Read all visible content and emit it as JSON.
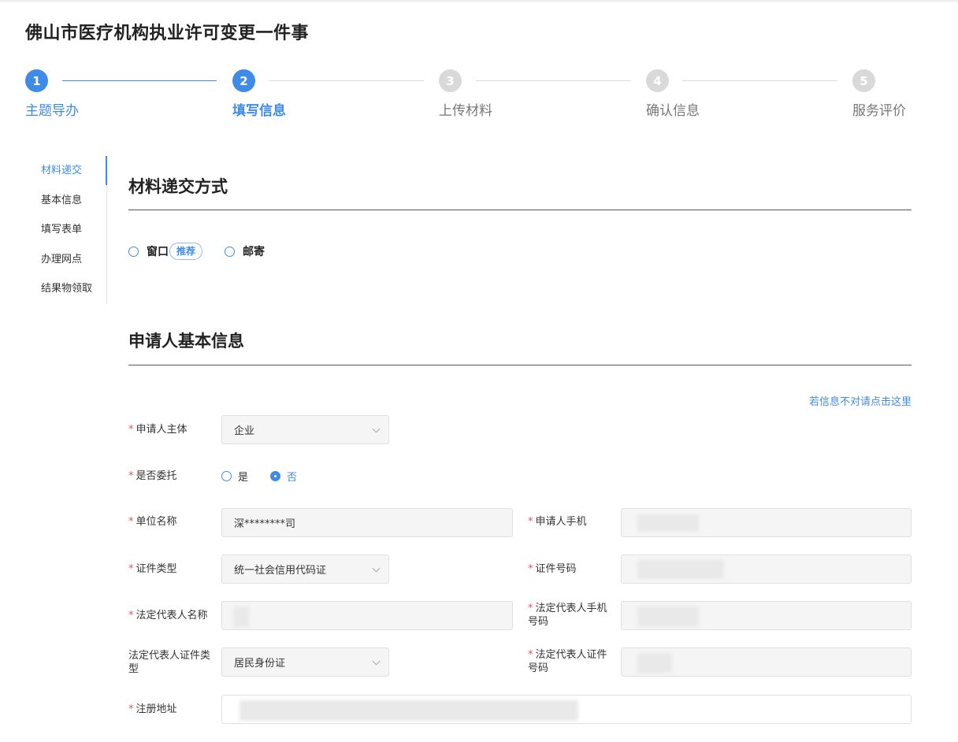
{
  "page": {
    "title": "佛山市医疗机构执业许可变更一件事"
  },
  "steps": [
    {
      "num": "1",
      "label": "主题导办",
      "state": "done"
    },
    {
      "num": "2",
      "label": "填写信息",
      "state": "current"
    },
    {
      "num": "3",
      "label": "上传材料",
      "state": "todo"
    },
    {
      "num": "4",
      "label": "确认信息",
      "state": "todo"
    },
    {
      "num": "5",
      "label": "服务评价",
      "state": "todo"
    }
  ],
  "sidebar": {
    "items": [
      {
        "label": "材料递交",
        "active": true
      },
      {
        "label": "基本信息"
      },
      {
        "label": "填写表单"
      },
      {
        "label": "办理网点"
      },
      {
        "label": "结果物领取"
      }
    ]
  },
  "delivery": {
    "title": "材料递交方式",
    "options": {
      "window": "窗口",
      "recommend": "推荐",
      "mail": "邮寄"
    }
  },
  "applicant": {
    "title": "申请人基本信息",
    "fix_link": "若信息不对请点击这里",
    "subject": {
      "label": "申请人主体",
      "value": "企业"
    },
    "entrust": {
      "label": "是否委托",
      "yes": "是",
      "no": "否",
      "selected": "否"
    },
    "unit_name": {
      "label": "单位名称",
      "value": "深********司"
    },
    "phone": {
      "label": "申请人手机"
    },
    "cert_type": {
      "label": "证件类型",
      "value": "统一社会信用代码证"
    },
    "cert_no": {
      "label": "证件号码"
    },
    "legal_name": {
      "label": "法定代表人名称"
    },
    "legal_phone": {
      "label1": "法定代表人手机",
      "label2": "号码"
    },
    "legal_cert_type": {
      "label1": "法定代表人证件类",
      "label2": "型",
      "value": "居民身份证"
    },
    "legal_cert_no": {
      "label1": "法定代表人证件",
      "label2": "号码"
    },
    "reg_address": {
      "label": "注册地址"
    }
  },
  "colors": {
    "accent": "#3f8ce8",
    "required": "#e55555",
    "inactive_step": "#d9d9d9"
  },
  "required_mark": "*"
}
